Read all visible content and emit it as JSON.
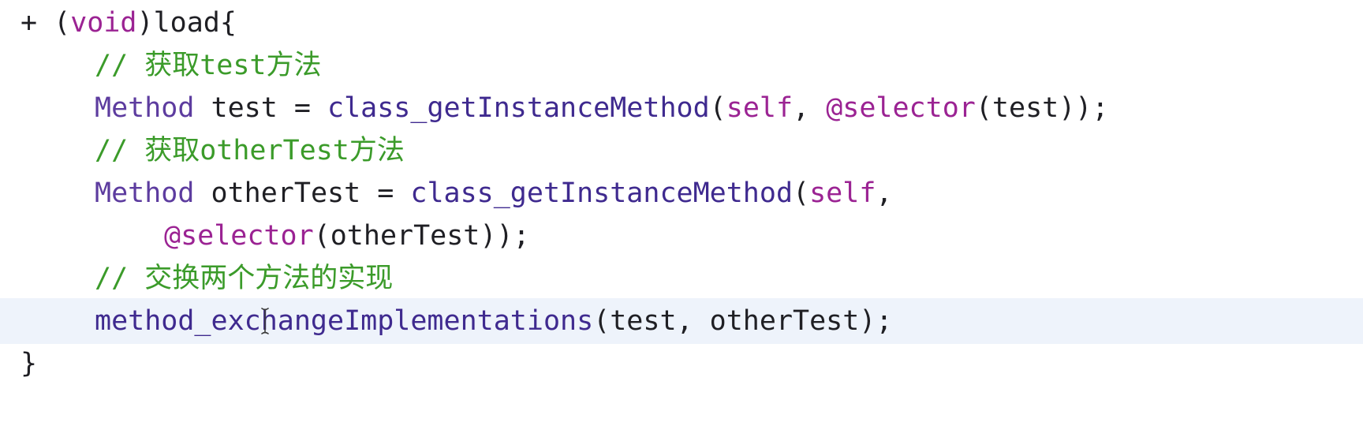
{
  "editor": {
    "language": "Objective-C",
    "current_line": 7,
    "colors": {
      "background": "#ffffff",
      "current_line_highlight": "#eef3fb",
      "plain": "#1f1f24",
      "keyword": "#9b2393",
      "type": "#5d3c9f",
      "function": "#3f2a8f",
      "comment": "#3b9b2a"
    },
    "lines": [
      {
        "indent": 0,
        "tokens": [
          {
            "text": "+ (",
            "kind": "plain"
          },
          {
            "text": "void",
            "kind": "keyword"
          },
          {
            "text": ")load{",
            "kind": "plain"
          }
        ]
      },
      {
        "indent": 1,
        "tokens": [
          {
            "text": "// 获取test方法",
            "kind": "comment"
          }
        ]
      },
      {
        "indent": 1,
        "tokens": [
          {
            "text": "Method",
            "kind": "type"
          },
          {
            "text": " test = ",
            "kind": "plain"
          },
          {
            "text": "class_getInstanceMethod",
            "kind": "func"
          },
          {
            "text": "(",
            "kind": "plain"
          },
          {
            "text": "self",
            "kind": "keyword"
          },
          {
            "text": ", ",
            "kind": "plain"
          },
          {
            "text": "@selector",
            "kind": "keyword"
          },
          {
            "text": "(test));",
            "kind": "plain"
          }
        ]
      },
      {
        "indent": 1,
        "tokens": [
          {
            "text": "// 获取otherTest方法",
            "kind": "comment"
          }
        ]
      },
      {
        "indent": 1,
        "tokens": [
          {
            "text": "Method",
            "kind": "type"
          },
          {
            "text": " otherTest = ",
            "kind": "plain"
          },
          {
            "text": "class_getInstanceMethod",
            "kind": "func"
          },
          {
            "text": "(",
            "kind": "plain"
          },
          {
            "text": "self",
            "kind": "keyword"
          },
          {
            "text": ",",
            "kind": "plain"
          }
        ]
      },
      {
        "indent": 2,
        "tokens": [
          {
            "text": "@selector",
            "kind": "keyword"
          },
          {
            "text": "(otherTest));",
            "kind": "plain"
          }
        ]
      },
      {
        "indent": 1,
        "tokens": [
          {
            "text": "// 交换两个方法的实现",
            "kind": "comment"
          }
        ]
      },
      {
        "indent": 1,
        "tokens": [
          {
            "text": "method_exchangeImplementations",
            "kind": "func"
          },
          {
            "text": "(test, otherTest);",
            "kind": "plain"
          }
        ]
      },
      {
        "indent": 0,
        "tokens": [
          {
            "text": "}",
            "kind": "plain"
          }
        ]
      }
    ]
  }
}
